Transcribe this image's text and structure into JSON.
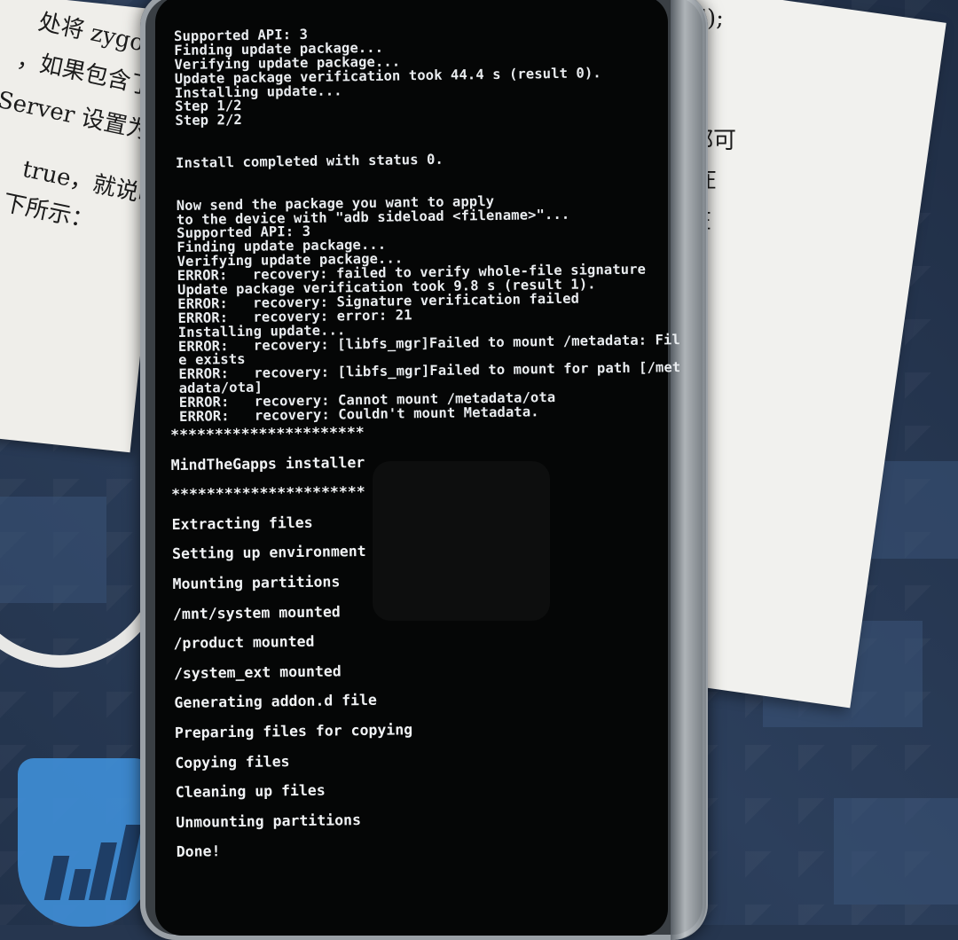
{
  "photo": {
    "background_text": {
      "left_page_lines": [
        "处将 zygote",
        "，如果包含了",
        "Server 设置为",
        "true，就说明",
        "下所示："
      ],
      "right_page_lines": [
        "\");",
        "都可",
        "在",
        "在"
      ]
    }
  },
  "terminal": {
    "log_lines": [
      "Supported API: 3",
      "Finding update package...",
      "Verifying update package...",
      "Update package verification took 44.4 s (result 0).",
      "Installing update...",
      "Step 1/2",
      "Step 2/2",
      "",
      "",
      "Install completed with status 0.",
      "",
      "",
      "Now send the package you want to apply",
      "to the device with \"adb sideload <filename>\"...",
      "Supported API: 3",
      "Finding update package...",
      "Verifying update package...",
      "ERROR:   recovery: failed to verify whole-file signature",
      "Update package verification took 9.8 s (result 1).",
      "ERROR:   recovery: Signature verification failed",
      "ERROR:   recovery: error: 21",
      "Installing update...",
      "ERROR:   recovery: [libfs_mgr]Failed to mount /metadata: Fil",
      "e exists",
      "ERROR:   recovery: [libfs_mgr]Failed to mount for path [/met",
      "adata/ota]",
      "ERROR:   recovery: Cannot mount /metadata/ota",
      "ERROR:   recovery: Couldn't mount Metadata."
    ],
    "installer_lines": [
      "**********************",
      "MindTheGapps installer",
      "**********************",
      "Extracting files",
      "Setting up environment",
      "Mounting partitions",
      "/mnt/system mounted",
      "/product mounted",
      "/system_ext mounted",
      "Generating addon.d file",
      "Preparing files for copying",
      "Copying files",
      "Cleaning up files",
      "Unmounting partitions",
      "Done!"
    ]
  }
}
